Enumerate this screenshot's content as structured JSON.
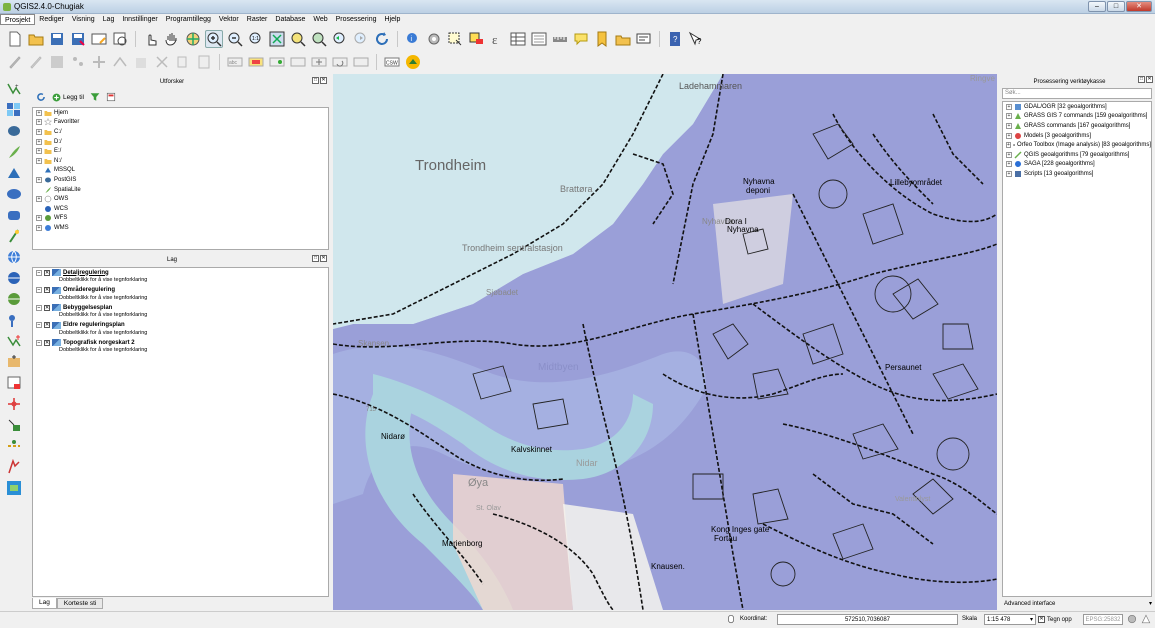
{
  "window": {
    "title": "QGIS2.4.0-Chugiak"
  },
  "menu": [
    "Prosjekt",
    "Rediger",
    "Visning",
    "Lag",
    "Innstillinger",
    "Programtillegg",
    "Vektor",
    "Raster",
    "Database",
    "Web",
    "Prosessering",
    "Hjelp"
  ],
  "browser": {
    "title": "Utforsker",
    "add_label": "Legg til",
    "items": [
      "Hjem",
      "Favoritter",
      "C:/",
      "D:/",
      "E:/",
      "N:/",
      "MSSQL",
      "PostGIS",
      "SpatiaLite",
      "OWS",
      "WCS",
      "WFS",
      "WMS"
    ]
  },
  "layers": {
    "title": "Lag",
    "hint": "Dobbeltklikk for å vise tegnforklaring",
    "items": [
      "Detaljregulering",
      "Områderegulering",
      "Bebyggelsesplan",
      "Eldre reguleringsplan",
      "Topografisk norgeskart 2"
    ]
  },
  "bottom_tabs": [
    "Lag",
    "Korteste sti"
  ],
  "map": {
    "labels": [
      "Ladehammaren",
      "Trondheim",
      "Brattøra",
      "Nyhavna deponi",
      "Lillebyområdet",
      "Nyhavna",
      "Dora I",
      "Nyhavna",
      "Trondheim sentralstasjon",
      "Sjøbadet",
      "Skansen",
      "Persaunet",
      "Nidarø",
      "Kalvskinnet",
      "Øya",
      "St. Olav",
      "Marienborg",
      "Kong Inges gate",
      "Fortau",
      "Knausen.",
      "Valentinlyst",
      "Ringve",
      "715",
      "Midtbyen",
      "Nidar"
    ]
  },
  "processing": {
    "title": "Prosessering verktøykasse",
    "search_placeholder": "Søk...",
    "items": [
      "GDAL/OGR [32 geoalgorithms]",
      "GRASS GIS 7 commands [159 geoalgorithms]",
      "GRASS commands [167 geoalgorithms]",
      "Models [3 geoalgorithms]",
      "Orfeo Toolbox (Image analysis) [83 geoalgorithms]",
      "QGIS geoalgorithms [79 geoalgorithms]",
      "SAGA [228 geoalgorithms]",
      "Scripts [13 geoalgorithms]"
    ],
    "advanced_label": "Advanced interface"
  },
  "status": {
    "coord_label": "Koordinat:",
    "coord_value": "572510,7036087",
    "scale_label": "Skala",
    "scale_value": "1:15 478",
    "render_label": "Tegn opp",
    "epsg": "EPSG:25832"
  }
}
